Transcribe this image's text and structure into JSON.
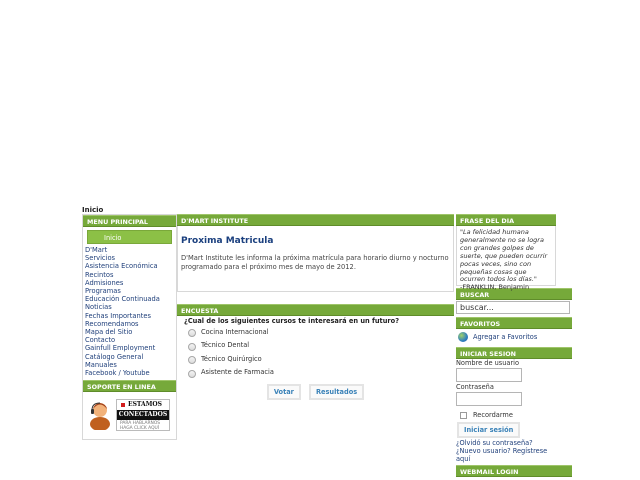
{
  "breadcrumb": "Inicio",
  "colors": {
    "header_green": "#76a93a",
    "button_green": "#8cc046",
    "title_blue": "#1a3f7e",
    "button_text": "#3a82b8"
  },
  "left": {
    "menu_header": "MENU PRINCIPAL",
    "inicio_label": "Inicio",
    "items": [
      "D'Mart",
      "Servicios",
      "Asistencia Económica",
      "Recintos",
      "Admisiones",
      "Programas",
      "Educación Continuada",
      "Noticias",
      "Fechas Importantes",
      "Recomendamos",
      "Mapa del Sitio",
      "Contacto",
      "Gainfull Employment",
      "Catálogo General",
      "Manuales",
      "Facebook / Youtube"
    ],
    "support_header": "SOPORTE EN LINEA",
    "support_badge": {
      "line1": "ESTAMOS",
      "line2": "CONECTADOS",
      "line3": "PARA HABLARNOS",
      "line4": "HAGA CLICK AQUÍ"
    }
  },
  "center": {
    "header": "D'MART INSTITUTE",
    "article_title": "Proxima Matricula",
    "article_body": "D'Mart Institute les informa la próxima matrícula para horario diurno y nocturno programado para el próximo mes de mayo de 2012.",
    "poll_header": "ENCUESTA",
    "poll_question": "¿Cual de los siguientes cursos te interesará en un futuro?",
    "poll_options": [
      "Cocina Internacional",
      "Técnico Dental",
      "Técnico Quirúrgico",
      "Asistente de Farmacia"
    ],
    "vote_label": "Votar",
    "results_label": "Resultados"
  },
  "right": {
    "quote_header": "FRASE DEL DIA",
    "quote_text": "\"La felicidad humana generalmente no se logra con grandes golpes de suerte, que pueden ocurrir pocas veces, sino con pequeñas cosas que ocurren todos los días.\"",
    "quote_author": "-FRANKLIN, Benjamin",
    "search_header": "BUSCAR",
    "search_value": "buscar...",
    "fav_header": "FAVORITOS",
    "fav_label": "Agregar a Favoritos",
    "login_header": "INICIAR SESION",
    "username_label": "Nombre de usuario",
    "password_label": "Contraseña",
    "remember_label": "Recordarme",
    "login_button": "Iniciar sesión",
    "forgot_password": "¿Olvidó su contraseña?",
    "new_user": "¿Nuevo usuario? Regístrese aquí",
    "webmail_header": "WEBMAIL LOGIN"
  }
}
